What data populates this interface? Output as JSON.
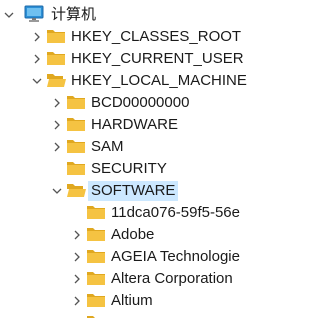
{
  "tree": {
    "root": {
      "label": "计算机",
      "icon": "computer-icon"
    },
    "hives": [
      {
        "label": "HKEY_CLASSES_ROOT",
        "state": "collapsed"
      },
      {
        "label": "HKEY_CURRENT_USER",
        "state": "collapsed"
      },
      {
        "label": "HKEY_LOCAL_MACHINE",
        "state": "expanded"
      }
    ],
    "hklm_children": [
      {
        "label": "BCD00000000",
        "state": "collapsed"
      },
      {
        "label": "HARDWARE",
        "state": "collapsed"
      },
      {
        "label": "SAM",
        "state": "collapsed"
      },
      {
        "label": "SECURITY",
        "state": "leaf"
      },
      {
        "label": "SOFTWARE",
        "state": "expanded",
        "selected": true
      }
    ],
    "software_children": [
      {
        "label": "11dca076-59f5-56e",
        "state": "leaf"
      },
      {
        "label": "Adobe",
        "state": "collapsed"
      },
      {
        "label": "AGEIA Technologie",
        "state": "collapsed"
      },
      {
        "label": "Altera Corporation",
        "state": "collapsed"
      },
      {
        "label": "Altium",
        "state": "collapsed"
      }
    ]
  },
  "colors": {
    "folder": "#f5c342",
    "folder_dark": "#e0a820",
    "chevron": "#555555",
    "selection": "#cce8ff"
  }
}
